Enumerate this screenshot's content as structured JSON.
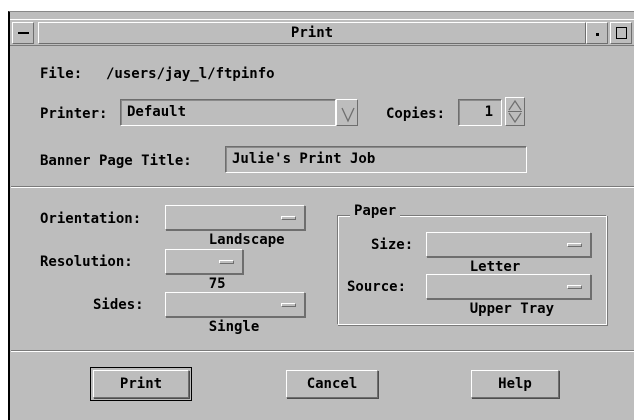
{
  "window": {
    "title": "Print"
  },
  "file": {
    "label": "File:",
    "value": "/users/jay_l/ftpinfo"
  },
  "printer": {
    "label": "Printer:",
    "value": "Default"
  },
  "copies": {
    "label": "Copies:",
    "value": "1"
  },
  "banner": {
    "label": "Banner Page Title:",
    "value": "Julie's Print Job"
  },
  "orientation": {
    "label": "Orientation:",
    "value": "Landscape"
  },
  "resolution": {
    "label": "Resolution:",
    "value": "75"
  },
  "sides": {
    "label": "Sides:",
    "value": "Single"
  },
  "paper": {
    "title": "Paper",
    "size": {
      "label": "Size:",
      "value": "Letter"
    },
    "source": {
      "label": "Source:",
      "value": "Upper Tray"
    }
  },
  "buttons": {
    "print": "Print",
    "cancel": "Cancel",
    "help": "Help"
  }
}
